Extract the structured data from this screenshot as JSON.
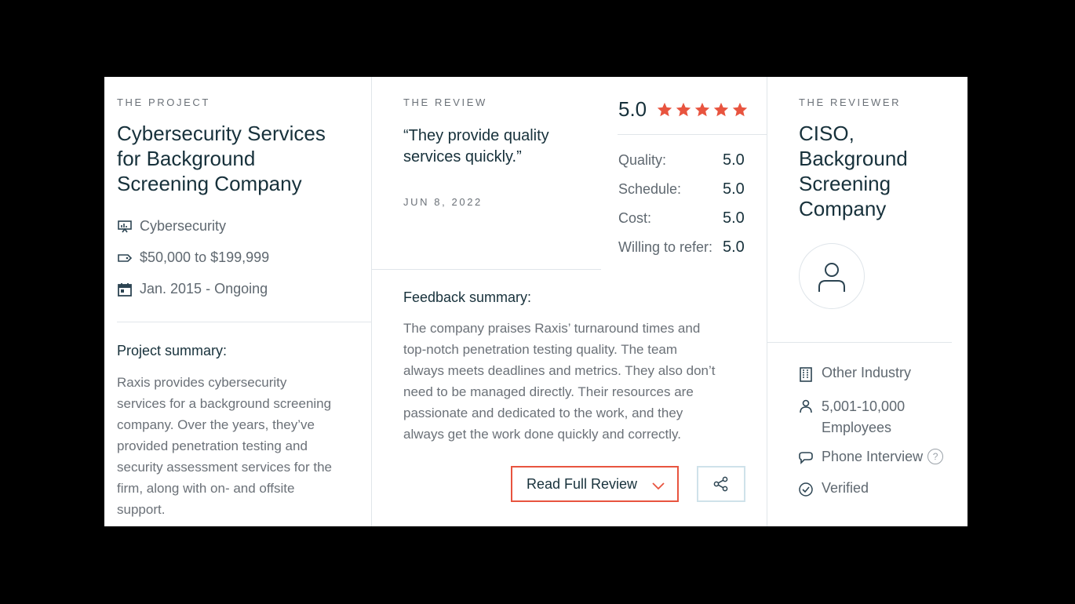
{
  "project": {
    "eyebrow": "THE PROJECT",
    "title_lines": [
      "Cybersecurity Services",
      "for Background",
      "Screening Company"
    ],
    "service": "Cybersecurity",
    "budget": "$50,000 to $199,999",
    "dates": "Jan. 2015 - Ongoing",
    "summary_heading": "Project summary:",
    "summary_lines": [
      "Raxis provides cybersecurity",
      "services for a background screening",
      "company. Over the years, they’ve",
      "provided penetration testing and",
      "security assessment services for the",
      "firm, along with on- and offsite",
      "support."
    ]
  },
  "review": {
    "eyebrow": "THE REVIEW",
    "quote_lines": [
      "“They provide quality",
      "services quickly.”"
    ],
    "date": "JUN 8, 2022",
    "overall": "5.0",
    "stars": 5,
    "star_color": "#e8543f",
    "ratings": [
      {
        "label": "Quality:",
        "value": "5.0"
      },
      {
        "label": "Schedule:",
        "value": "5.0"
      },
      {
        "label": "Cost:",
        "value": "5.0"
      },
      {
        "label": "Willing to refer:",
        "value": "5.0"
      }
    ],
    "feedback_heading": "Feedback summary:",
    "feedback_lines": [
      "The company praises Raxis’ turnaround times and",
      "top-notch penetration testing quality. The team",
      "always meets deadlines and metrics. They also don’t",
      "need to be managed directly. Their resources are",
      "passionate and dedicated to the work, and they",
      "always get the work done quickly and correctly."
    ],
    "read_button": "Read Full Review"
  },
  "reviewer": {
    "eyebrow": "THE REVIEWER",
    "title_lines": [
      "CISO,",
      "Background",
      "Screening",
      "Company"
    ],
    "industry": "Other Industry",
    "employees_lines": [
      "5,001-10,000",
      "Employees"
    ],
    "interview": "Phone Interview",
    "help": "?",
    "verified": "Verified"
  },
  "colors": {
    "accent": "#e8543f",
    "title": "#17313b",
    "muted": "#6b7178",
    "divider": "#e1e6ea"
  }
}
